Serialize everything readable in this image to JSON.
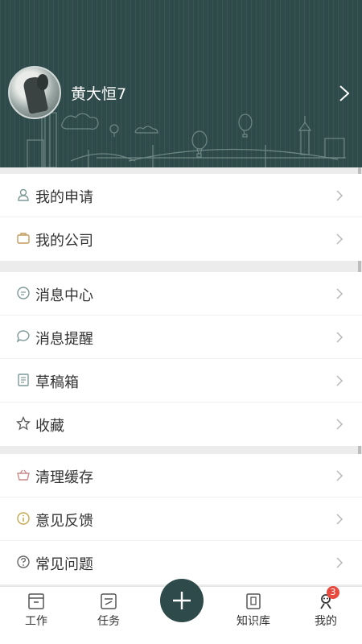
{
  "profile": {
    "username": "黄大恒7"
  },
  "menu_groups": [
    [
      {
        "label": "我的申请",
        "icon": "user-icon"
      },
      {
        "label": "我的公司",
        "icon": "briefcase-icon"
      }
    ],
    [
      {
        "label": "消息中心",
        "icon": "message-center-icon"
      },
      {
        "label": "消息提醒",
        "icon": "chat-bubble-icon"
      },
      {
        "label": "草稿箱",
        "icon": "draft-icon"
      },
      {
        "label": "收藏",
        "icon": "star-icon"
      }
    ],
    [
      {
        "label": "清理缓存",
        "icon": "basket-icon"
      },
      {
        "label": "意见反馈",
        "icon": "info-icon"
      },
      {
        "label": "常见问题",
        "icon": "question-icon"
      }
    ]
  ],
  "bottom_nav": {
    "tabs": [
      {
        "label": "工作",
        "icon": "inbox-icon"
      },
      {
        "label": "任务",
        "icon": "task-icon"
      },
      {
        "label": "知识库",
        "icon": "knowledge-base-icon"
      },
      {
        "label": "我的",
        "icon": "profile-icon",
        "badge": "3"
      }
    ],
    "fab_icon": "plus-icon"
  },
  "colors": {
    "header_bg": "#2f4a4a",
    "fab_bg": "#2f4a4a",
    "badge_bg": "#e94a3f",
    "text": "#333333",
    "icon": "#7d9a97"
  }
}
